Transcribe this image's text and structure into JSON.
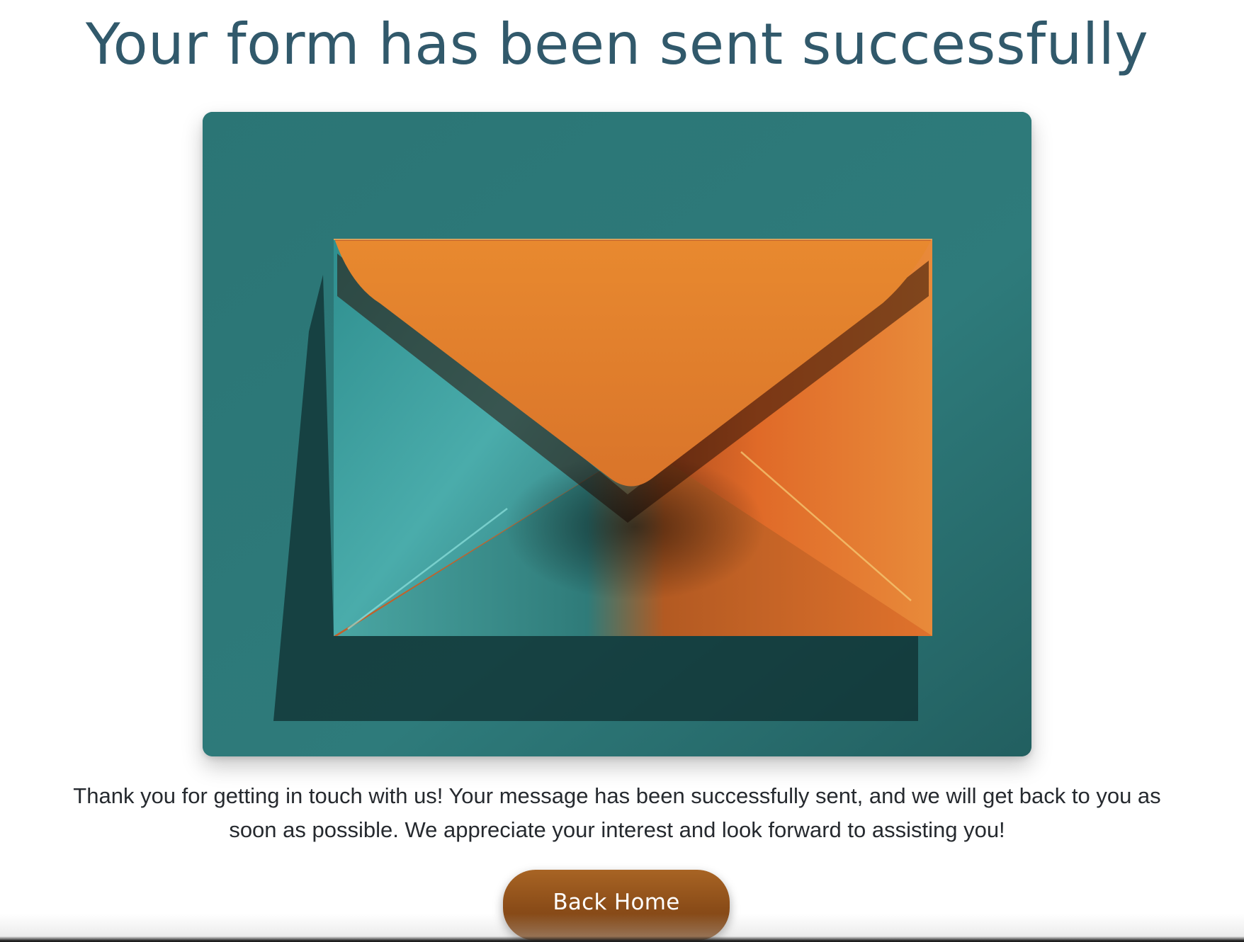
{
  "page": {
    "title": "Your form has been sent successfully",
    "message": "Thank you for getting in touch with us! Your message has been successfully sent, and we will get back to you as soon as possible. We appreciate your interest and look forward to assisting you!",
    "back_button_label": "Back Home"
  },
  "hero_image": {
    "subject": "envelope-illustration",
    "colors": {
      "background": "#2f7a7a",
      "envelope_orange": "#e07a2a",
      "envelope_teal": "#3a9a9a"
    }
  },
  "colors": {
    "title": "#31596b",
    "text": "#262a2f",
    "button": "#8a4c18"
  }
}
